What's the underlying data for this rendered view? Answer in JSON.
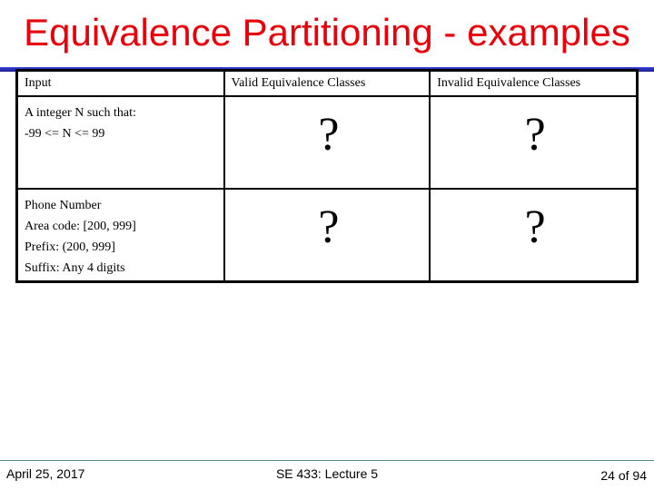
{
  "slide": {
    "title": "Equivalence Partitioning - examples",
    "title_color": "#e8000b",
    "rule_color": "#1f24a8"
  },
  "table": {
    "headers": [
      "Input",
      "Valid Equivalence Classes",
      "Invalid Equivalence Classes"
    ],
    "rows": [
      {
        "input_lines": [
          "A integer N such that:",
          "-99 <= N <= 99"
        ],
        "valid": "?",
        "invalid": "?"
      },
      {
        "input_lines": [
          "Phone Number",
          "Area code: [200, 999]",
          "Prefix: (200, 999]",
          "Suffix: Any 4 digits"
        ],
        "valid": "?",
        "invalid": "?"
      }
    ]
  },
  "footer": {
    "date": "April 25, 2017",
    "course": "SE 433: Lecture 5",
    "page": "24 of 94"
  }
}
